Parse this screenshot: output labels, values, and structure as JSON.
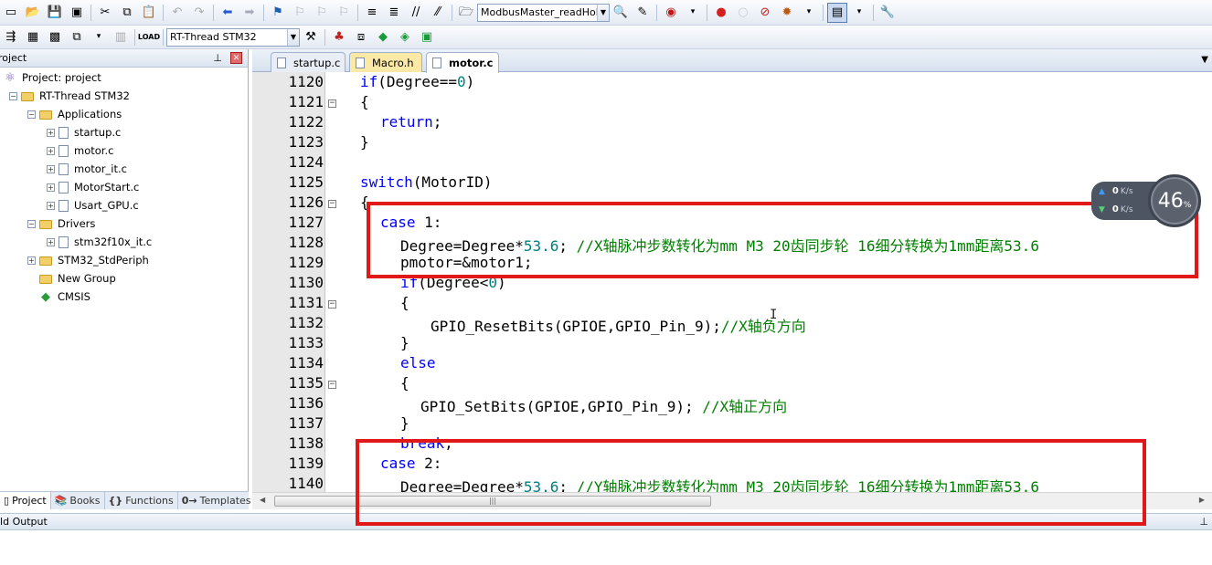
{
  "toolbar1": {
    "target_combo": "ModbusMaster_readHold"
  },
  "toolbar2": {
    "target_select": "RT-Thread STM32"
  },
  "project_pane": {
    "title": "roject",
    "tree": [
      {
        "label": "Project: project"
      },
      {
        "label": "RT-Thread STM32"
      },
      {
        "label": "Applications"
      },
      {
        "label": "startup.c"
      },
      {
        "label": "motor.c"
      },
      {
        "label": "motor_it.c"
      },
      {
        "label": "MotorStart.c"
      },
      {
        "label": "Usart_GPU.c"
      },
      {
        "label": "Drivers"
      },
      {
        "label": "stm32f10x_it.c"
      },
      {
        "label": "STM32_StdPeriph"
      },
      {
        "label": "New Group"
      },
      {
        "label": "CMSIS"
      }
    ],
    "tabs": [
      {
        "label": "Project"
      },
      {
        "label": "Books"
      },
      {
        "label": "Functions"
      },
      {
        "label": "Templates"
      }
    ],
    "tab_icons": [
      "{}",
      "0→"
    ]
  },
  "editor": {
    "tabs": [
      {
        "label": "startup.c"
      },
      {
        "label": "Macro.h"
      },
      {
        "label": "motor.c"
      }
    ],
    "line_numbers": [
      "1120",
      "1121",
      "1122",
      "1123",
      "1124",
      "1125",
      "1126",
      "1127",
      "1128",
      "1129",
      "1130",
      "1131",
      "1132",
      "1133",
      "1134",
      "1135",
      "1136",
      "1137",
      "1138",
      "1139",
      "1140"
    ],
    "lines": [
      {
        "a": "if",
        "b": "(Degree==",
        "c": "0",
        "d": ")"
      },
      {
        "a": "{"
      },
      {
        "a": "return",
        "b": ";"
      },
      {
        "a": "}"
      },
      {
        "a": ""
      },
      {
        "a": "switch",
        "b": "(MotorID)"
      },
      {
        "a": "{"
      },
      {
        "a": "case",
        "b": " 1:"
      },
      {
        "a": "Degree=Degree*",
        "b": "53.6",
        "c": "; ",
        "d": "//X轴脉冲步数转化为mm M3 20齿同步轮 16细分转换为1mm距离53.6"
      },
      {
        "a": "pmotor=&motor1;"
      },
      {
        "a": "if",
        "b": "(Degree<",
        "c": "0",
        "d": ")"
      },
      {
        "a": "{"
      },
      {
        "a": "GPIO_ResetBits(GPIOE,GPIO_Pin_9);",
        "b": "//X轴负方向"
      },
      {
        "a": "}"
      },
      {
        "a": "else"
      },
      {
        "a": "{"
      },
      {
        "a": "GPIO_SetBits(GPIOE,GPIO_Pin_9); ",
        "b": "//X轴正方向"
      },
      {
        "a": "}"
      },
      {
        "a": "break",
        "b": ";"
      },
      {
        "a": "case",
        "b": " 2:"
      },
      {
        "a": "Degree=Degree*",
        "b": "53.6",
        "c": "; ",
        "d": "//Y轴脉冲步数转化为mm M3 20齿同步轮 16细分转换为1mm距离53.6"
      }
    ]
  },
  "build_output": {
    "title": "ild Output"
  },
  "net_widget": {
    "up_value": "0",
    "up_unit": "K/s",
    "down_value": "0",
    "down_unit": "K/s",
    "cpu_value": "46",
    "cpu_unit": "%"
  }
}
